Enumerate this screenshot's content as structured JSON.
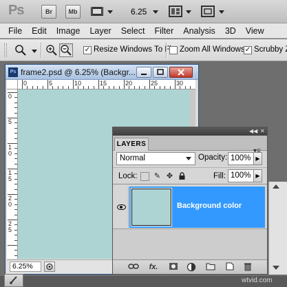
{
  "app": {
    "logo": "Ps",
    "bridge_label": "Br",
    "minibridge_label": "Mb",
    "zoom_value": "6.25"
  },
  "menu": {
    "items": [
      "File",
      "Edit",
      "Image",
      "Layer",
      "Select",
      "Filter",
      "Analysis",
      "3D",
      "View"
    ]
  },
  "options": {
    "resize_windows_label": "Resize Windows To Fit",
    "resize_windows_checked": true,
    "zoom_all_label": "Zoom All Windows",
    "zoom_all_checked": false,
    "scrubby_label": "Scrubby Z",
    "scrubby_checked": true
  },
  "document": {
    "title": "frame2.psd @ 6.25% (Backgr...",
    "zoom_label": "6.25%",
    "canvas_color": "#aed3d3",
    "ruler_h_labels": [
      "0",
      "5",
      "10",
      "15",
      "20",
      "25",
      "30"
    ],
    "ruler_v_labels": [
      "0",
      "5",
      "1 0",
      "1 5",
      "2 0",
      "2 5"
    ]
  },
  "layers_panel": {
    "tab_label": "LAYERS",
    "blend_mode": "Normal",
    "opacity_label": "Opacity:",
    "opacity_value": "100%",
    "lock_label": "Lock:",
    "fill_label": "Fill:",
    "fill_value": "100%",
    "layers": [
      {
        "name": "Background color",
        "visible": true,
        "selected": true,
        "thumb_color": "#aed3d3"
      }
    ],
    "footer_icons": [
      "link-icon",
      "fx-icon",
      "mask-icon",
      "adjustment-icon",
      "group-folder-icon",
      "new-layer-icon",
      "trash-icon"
    ],
    "fx_label": "fx."
  },
  "footer": {
    "watermark": "wtvid.com"
  },
  "colors": {
    "selection_blue": "#3399ff",
    "canvas_teal": "#aed3d3"
  }
}
